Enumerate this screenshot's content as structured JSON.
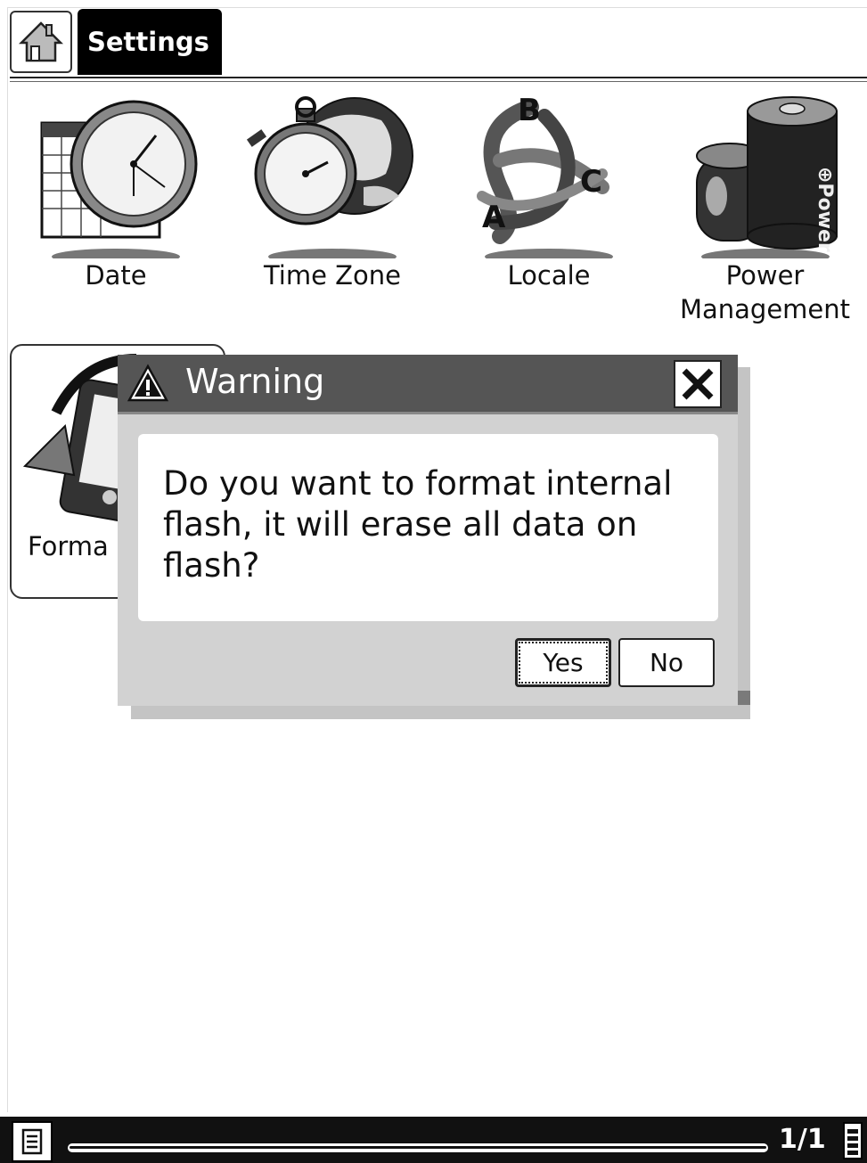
{
  "header": {
    "home_icon": "home-icon",
    "tab_label": "Settings"
  },
  "tiles": [
    {
      "label": "Date",
      "icon": "date-clock-icon"
    },
    {
      "label": "Time Zone",
      "icon": "time-zone-globe-icon"
    },
    {
      "label": "Locale",
      "icon": "locale-abc-icon"
    },
    {
      "label": "Power\nManagement",
      "icon": "power-battery-icon"
    },
    {
      "label": "Forma",
      "icon": "format-device-icon"
    }
  ],
  "dialog": {
    "title": "Warning",
    "message": "Do you want to format internal flash, it will erase all data on flash?",
    "yes_label": "Yes",
    "no_label": "No",
    "close_icon": "close-icon",
    "warning_icon": "warning-icon"
  },
  "status_bar": {
    "page": "1/1",
    "menu_icon": "menu-icon",
    "battery_icon": "battery-icon"
  }
}
